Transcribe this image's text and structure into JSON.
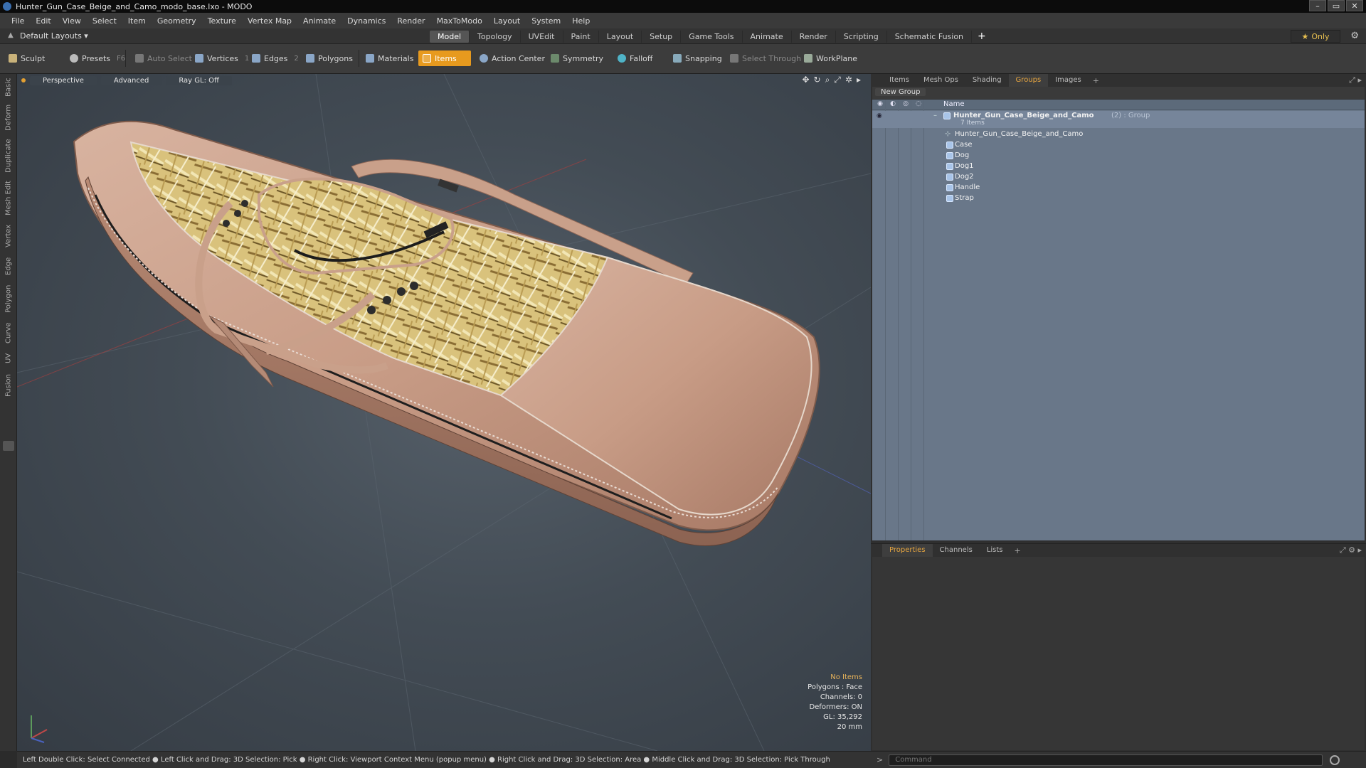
{
  "window": {
    "title": "Hunter_Gun_Case_Beige_and_Camo_modo_base.lxo - MODO",
    "buttons": [
      "–",
      "▭",
      "✕"
    ]
  },
  "menu": [
    "File",
    "Edit",
    "View",
    "Select",
    "Item",
    "Geometry",
    "Texture",
    "Vertex Map",
    "Animate",
    "Dynamics",
    "Render",
    "MaxToModo",
    "Layout",
    "System",
    "Help"
  ],
  "layout_bar": {
    "layouts_label": "Default Layouts ▾",
    "tabs": [
      "Model",
      "Topology",
      "UVEdit",
      "Paint",
      "Layout",
      "Setup",
      "Game Tools",
      "Animate",
      "Render",
      "Scripting",
      "Schematic Fusion"
    ],
    "active_tab": "Model",
    "add": "+",
    "only_label": "Only",
    "only_star": "★",
    "gear": "⚙"
  },
  "toolbar": {
    "sculpt": "Sculpt",
    "presets": "Presets",
    "presets_key": "F6",
    "auto_select": "Auto Select",
    "vertices": "Vertices",
    "vertices_key": "1",
    "edges": "Edges",
    "edges_key": "2",
    "polygons": "Polygons",
    "materials": "Materials",
    "items": "Items",
    "action_center": "Action Center",
    "symmetry": "Symmetry",
    "falloff": "Falloff",
    "snapping": "Snapping",
    "select_through": "Select Through",
    "workplane": "WorkPlane"
  },
  "left_tabs": [
    "Basic",
    "Deform",
    "Duplicate",
    "Mesh Edit",
    "Vertex",
    "Edge",
    "Polygon",
    "Curve",
    "UV",
    "Fusion"
  ],
  "viewport": {
    "view_mode": "Perspective",
    "shading": "Advanced",
    "raygl": "Ray GL: Off",
    "info": {
      "no_items": "No Items",
      "polygons": "Polygons : Face",
      "channels": "Channels: 0",
      "deformers": "Deformers: ON",
      "gl": "GL: 35,292",
      "scale": "20 mm"
    }
  },
  "status_bar": "Left Double Click: Select Connected ● Left Click and Drag: 3D Selection: Pick ● Right Click: Viewport Context Menu (popup menu) ● Right Click and Drag: 3D Selection: Area ● Middle Click and Drag: 3D Selection: Pick Through",
  "command": {
    "placeholder": "Command",
    "arrow": ">"
  },
  "groups_panel": {
    "tabs": [
      "Items",
      "Mesh Ops",
      "Shading",
      "Groups",
      "Images"
    ],
    "active_tab": "Groups",
    "add": "+",
    "new_group": "New Group",
    "name_header": "Name",
    "group": {
      "name": "Hunter_Gun_Case_Beige_and_Camo",
      "count_tag": "(2) : Group",
      "items_count": "7 Items"
    },
    "items": [
      "Hunter_Gun_Case_Beige_and_Camo",
      "Case",
      "Dog",
      "Dog1",
      "Dog2",
      "Handle",
      "Strap"
    ]
  },
  "properties_panel": {
    "tabs": [
      "Properties",
      "Channels",
      "Lists"
    ],
    "active_tab": "Properties",
    "add": "+"
  },
  "colors": {
    "accent": "#e79a1e",
    "case_leather": "#c9a08a",
    "camo": "#d8c07a",
    "list_bg": "#697789"
  }
}
